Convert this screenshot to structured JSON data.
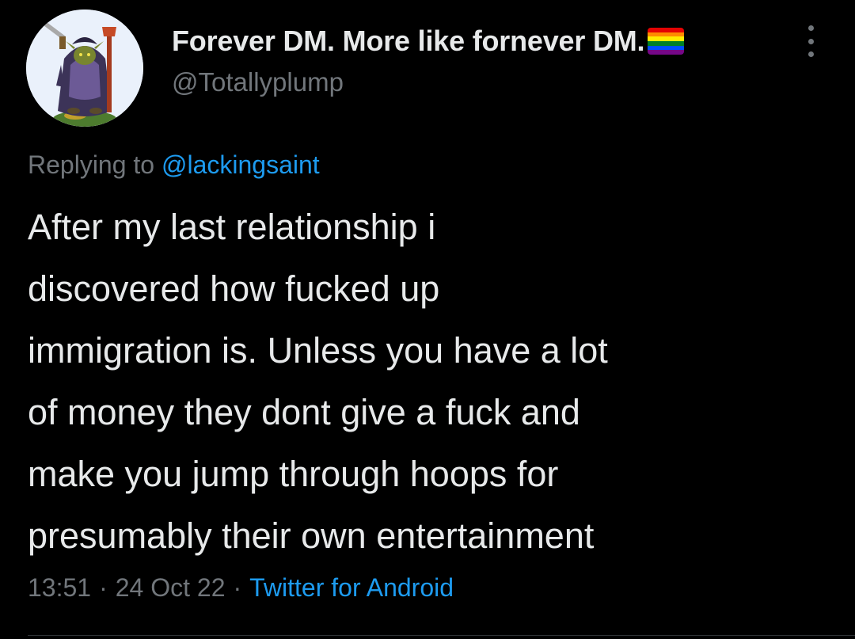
{
  "tweet": {
    "author": {
      "display_name": "Forever DM. More like fornever DM.",
      "handle": "@Totallyplump",
      "avatar_icon": "goblin-warrior-avatar",
      "badge_icon": "rainbow-flag-emoji"
    },
    "more_icon": "more-vertical-icon",
    "reply": {
      "prefix": "Replying to",
      "to_handle": "@lackingsaint"
    },
    "text_lines": [
      "After my last relationship i",
      "discovered how fucked up",
      "immigration is. Unless you have a lot",
      "of money they dont give a fuck and",
      "make you jump through hoops for",
      "presumably their own entertainment"
    ],
    "time": "13:51",
    "date": "24 Oct 22",
    "separator": "·",
    "source": "Twitter for Android"
  },
  "colors": {
    "background": "#000000",
    "text_primary": "#e7e9ea",
    "text_secondary": "#71767b",
    "link": "#1d9bf0",
    "pride_flag": [
      "#e40303",
      "#ff8c00",
      "#ffed00",
      "#008026",
      "#004dff",
      "#750787"
    ]
  }
}
